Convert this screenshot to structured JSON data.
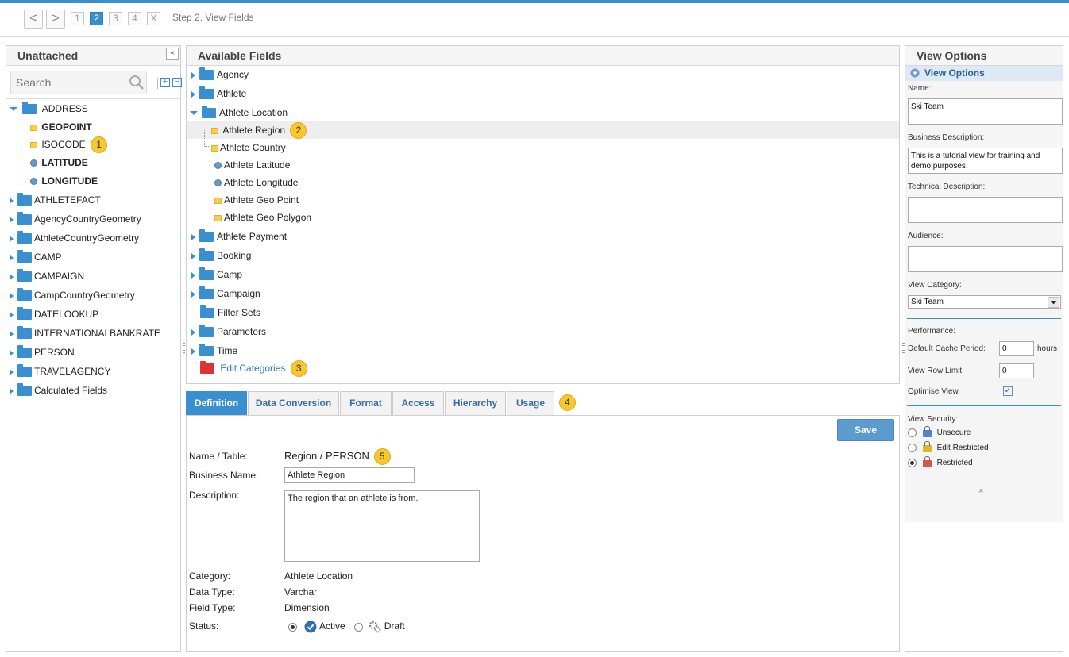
{
  "wizard": {
    "back": "<",
    "forward": ">",
    "steps": [
      "1",
      "2",
      "3",
      "4",
      "X"
    ],
    "active_step": "2",
    "title": "Step 2. View Fields"
  },
  "unattached": {
    "title": "Unattached",
    "collapse": "«",
    "search_placeholder": "Search",
    "expand_all": "+",
    "collapse_all": "−",
    "items": [
      {
        "label": "ADDRESS",
        "kind": "folder",
        "expanded": true
      },
      {
        "label": "GEOPOINT",
        "kind": "square",
        "bold": true
      },
      {
        "label": "ISOCODE",
        "kind": "square",
        "badge": "1"
      },
      {
        "label": "LATITUDE",
        "kind": "circle",
        "bold": true
      },
      {
        "label": "LONGITUDE",
        "kind": "circle",
        "bold": true
      },
      {
        "label": "ATHLETEFACT",
        "kind": "folder"
      },
      {
        "label": "AgencyCountryGeometry",
        "kind": "folder"
      },
      {
        "label": "AthleteCountryGeometry",
        "kind": "folder"
      },
      {
        "label": "CAMP",
        "kind": "folder"
      },
      {
        "label": "CAMPAIGN",
        "kind": "folder"
      },
      {
        "label": "CampCountryGeometry",
        "kind": "folder"
      },
      {
        "label": "DATELOOKUP",
        "kind": "folder"
      },
      {
        "label": "INTERNATIONALBANKRATE",
        "kind": "folder"
      },
      {
        "label": "PERSON",
        "kind": "folder"
      },
      {
        "label": "TRAVELAGENCY",
        "kind": "folder"
      },
      {
        "label": "Calculated Fields",
        "kind": "folder"
      }
    ]
  },
  "available": {
    "title": "Available Fields",
    "items": [
      {
        "label": "Agency",
        "kind": "folder",
        "arrow": "right"
      },
      {
        "label": "Athlete",
        "kind": "folder",
        "arrow": "right"
      },
      {
        "label": "Athlete Location",
        "kind": "folder",
        "arrow": "down"
      },
      {
        "label": "Athlete Region",
        "kind": "square",
        "badge": "2",
        "selected": true
      },
      {
        "label": "Athlete Country",
        "kind": "square"
      },
      {
        "label": "Athlete Latitude",
        "kind": "circle"
      },
      {
        "label": "Athlete Longitude",
        "kind": "circle"
      },
      {
        "label": "Athlete Geo Point",
        "kind": "square"
      },
      {
        "label": "Athlete Geo Polygon",
        "kind": "square"
      },
      {
        "label": "Athlete Payment",
        "kind": "folder",
        "arrow": "right"
      },
      {
        "label": "Booking",
        "kind": "folder",
        "arrow": "right"
      },
      {
        "label": "Camp",
        "kind": "folder",
        "arrow": "right"
      },
      {
        "label": "Campaign",
        "kind": "folder",
        "arrow": "right"
      },
      {
        "label": "Filter Sets",
        "kind": "folder"
      },
      {
        "label": "Parameters",
        "kind": "folder",
        "arrow": "right"
      },
      {
        "label": "Time",
        "kind": "folder",
        "arrow": "right"
      },
      {
        "label": "Edit Categories",
        "kind": "red-folder",
        "badge": "3",
        "link": true
      }
    ]
  },
  "tabs": {
    "items": [
      "Definition",
      "Data Conversion",
      "Format",
      "Access",
      "Hierarchy",
      "Usage"
    ],
    "active": "Definition",
    "badge": "4"
  },
  "definition": {
    "save": "Save",
    "name_table_label": "Name / Table:",
    "name_table_value": "Region / PERSON",
    "name_badge": "5",
    "business_name_label": "Business Name:",
    "business_name_value": "Athlete Region",
    "description_label": "Description:",
    "description_value": "The region that an athlete is from.",
    "category_label": "Category:",
    "category_value": "Athlete Location",
    "data_type_label": "Data Type:",
    "data_type_value": "Varchar",
    "field_type_label": "Field Type:",
    "field_type_value": "Dimension",
    "status_label": "Status:",
    "status_active": "Active",
    "status_draft": "Draft"
  },
  "view_options": {
    "title": "View Options",
    "section": "View Options",
    "name_label": "Name:",
    "name_value": "Ski Team",
    "business_desc_label": "Business Description:",
    "business_desc_value": "This is a tutorial view for training and demo purposes.",
    "technical_desc_label": "Technical Description:",
    "technical_desc_value": "",
    "audience_label": "Audience:",
    "audience_value": "",
    "category_label": "View Category:",
    "category_value": "Ski Team",
    "performance_label": "Performance:",
    "cache_label": "Default Cache Period:",
    "cache_value": "0",
    "cache_unit": "hours",
    "row_limit_label": "View Row Limit:",
    "row_limit_value": "0",
    "optimise_label": "Optimise View",
    "optimise_checked": "✓",
    "security_label": "View Security:",
    "security_unsecure": "Unsecure",
    "security_edit": "Edit Restricted",
    "security_restricted": "Restricted",
    "footer_glyph": "⩡"
  }
}
